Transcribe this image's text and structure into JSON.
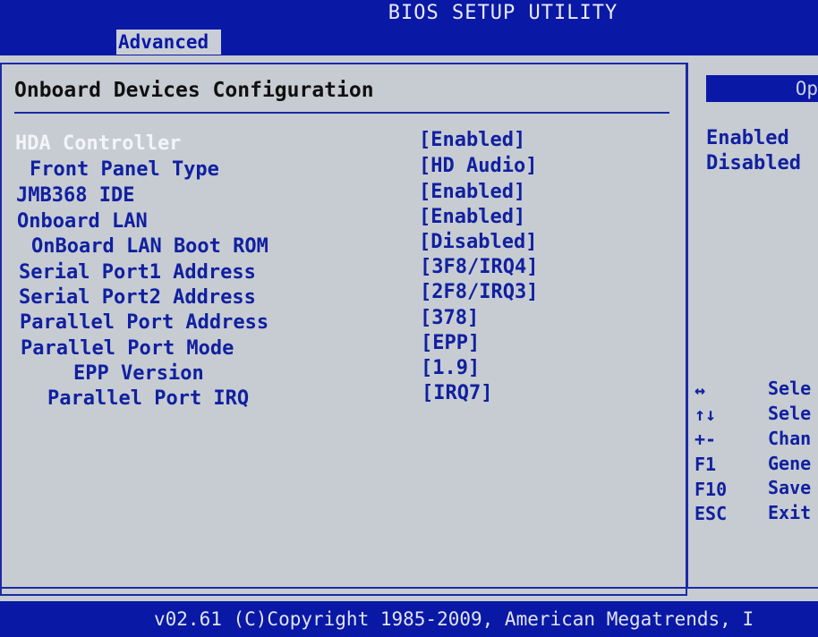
{
  "header": {
    "title": "BIOS SETUP UTILITY",
    "active_tab": "Advanced"
  },
  "section": {
    "title": "Onboard Devices Configuration"
  },
  "settings": [
    {
      "label": "HDA Controller",
      "value": "[Enabled]"
    },
    {
      "label": "Front Panel Type",
      "value": "[HD Audio]"
    },
    {
      "label": "JMB368 IDE",
      "value": "[Enabled]"
    },
    {
      "label": "Onboard LAN",
      "value": "[Enabled]"
    },
    {
      "label": "OnBoard LAN Boot ROM",
      "value": "[Disabled]"
    },
    {
      "label": "Serial Port1 Address",
      "value": "[3F8/IRQ4]"
    },
    {
      "label": "Serial Port2 Address",
      "value": "[2F8/IRQ3]"
    },
    {
      "label": "Parallel Port Address",
      "value": "[378]"
    },
    {
      "label": "Parallel Port Mode",
      "value": "[EPP]"
    },
    {
      "label": "EPP Version",
      "value": "[1.9]"
    },
    {
      "label": "Parallel Port IRQ",
      "value": "[IRQ7]"
    }
  ],
  "help": {
    "header": "Op",
    "options": [
      "Enabled",
      "Disabled"
    ],
    "keys": [
      {
        "key": "↔",
        "desc": "Sele"
      },
      {
        "key": "↑↓",
        "desc": "Sele"
      },
      {
        "key": "+-",
        "desc": "Chan"
      },
      {
        "key": "F1",
        "desc": "Gene"
      },
      {
        "key": "F10",
        "desc": "Save"
      },
      {
        "key": "ESC",
        "desc": "Exit"
      }
    ]
  },
  "footer": {
    "text": "v02.61 (C)Copyright 1985-2009, American Megatrends, I"
  },
  "colors": {
    "header_bg": "#0a18a6",
    "panel_bg": "#c7ccd2",
    "text_blue": "#1020a0",
    "selected_text": "#f2f4f8"
  }
}
